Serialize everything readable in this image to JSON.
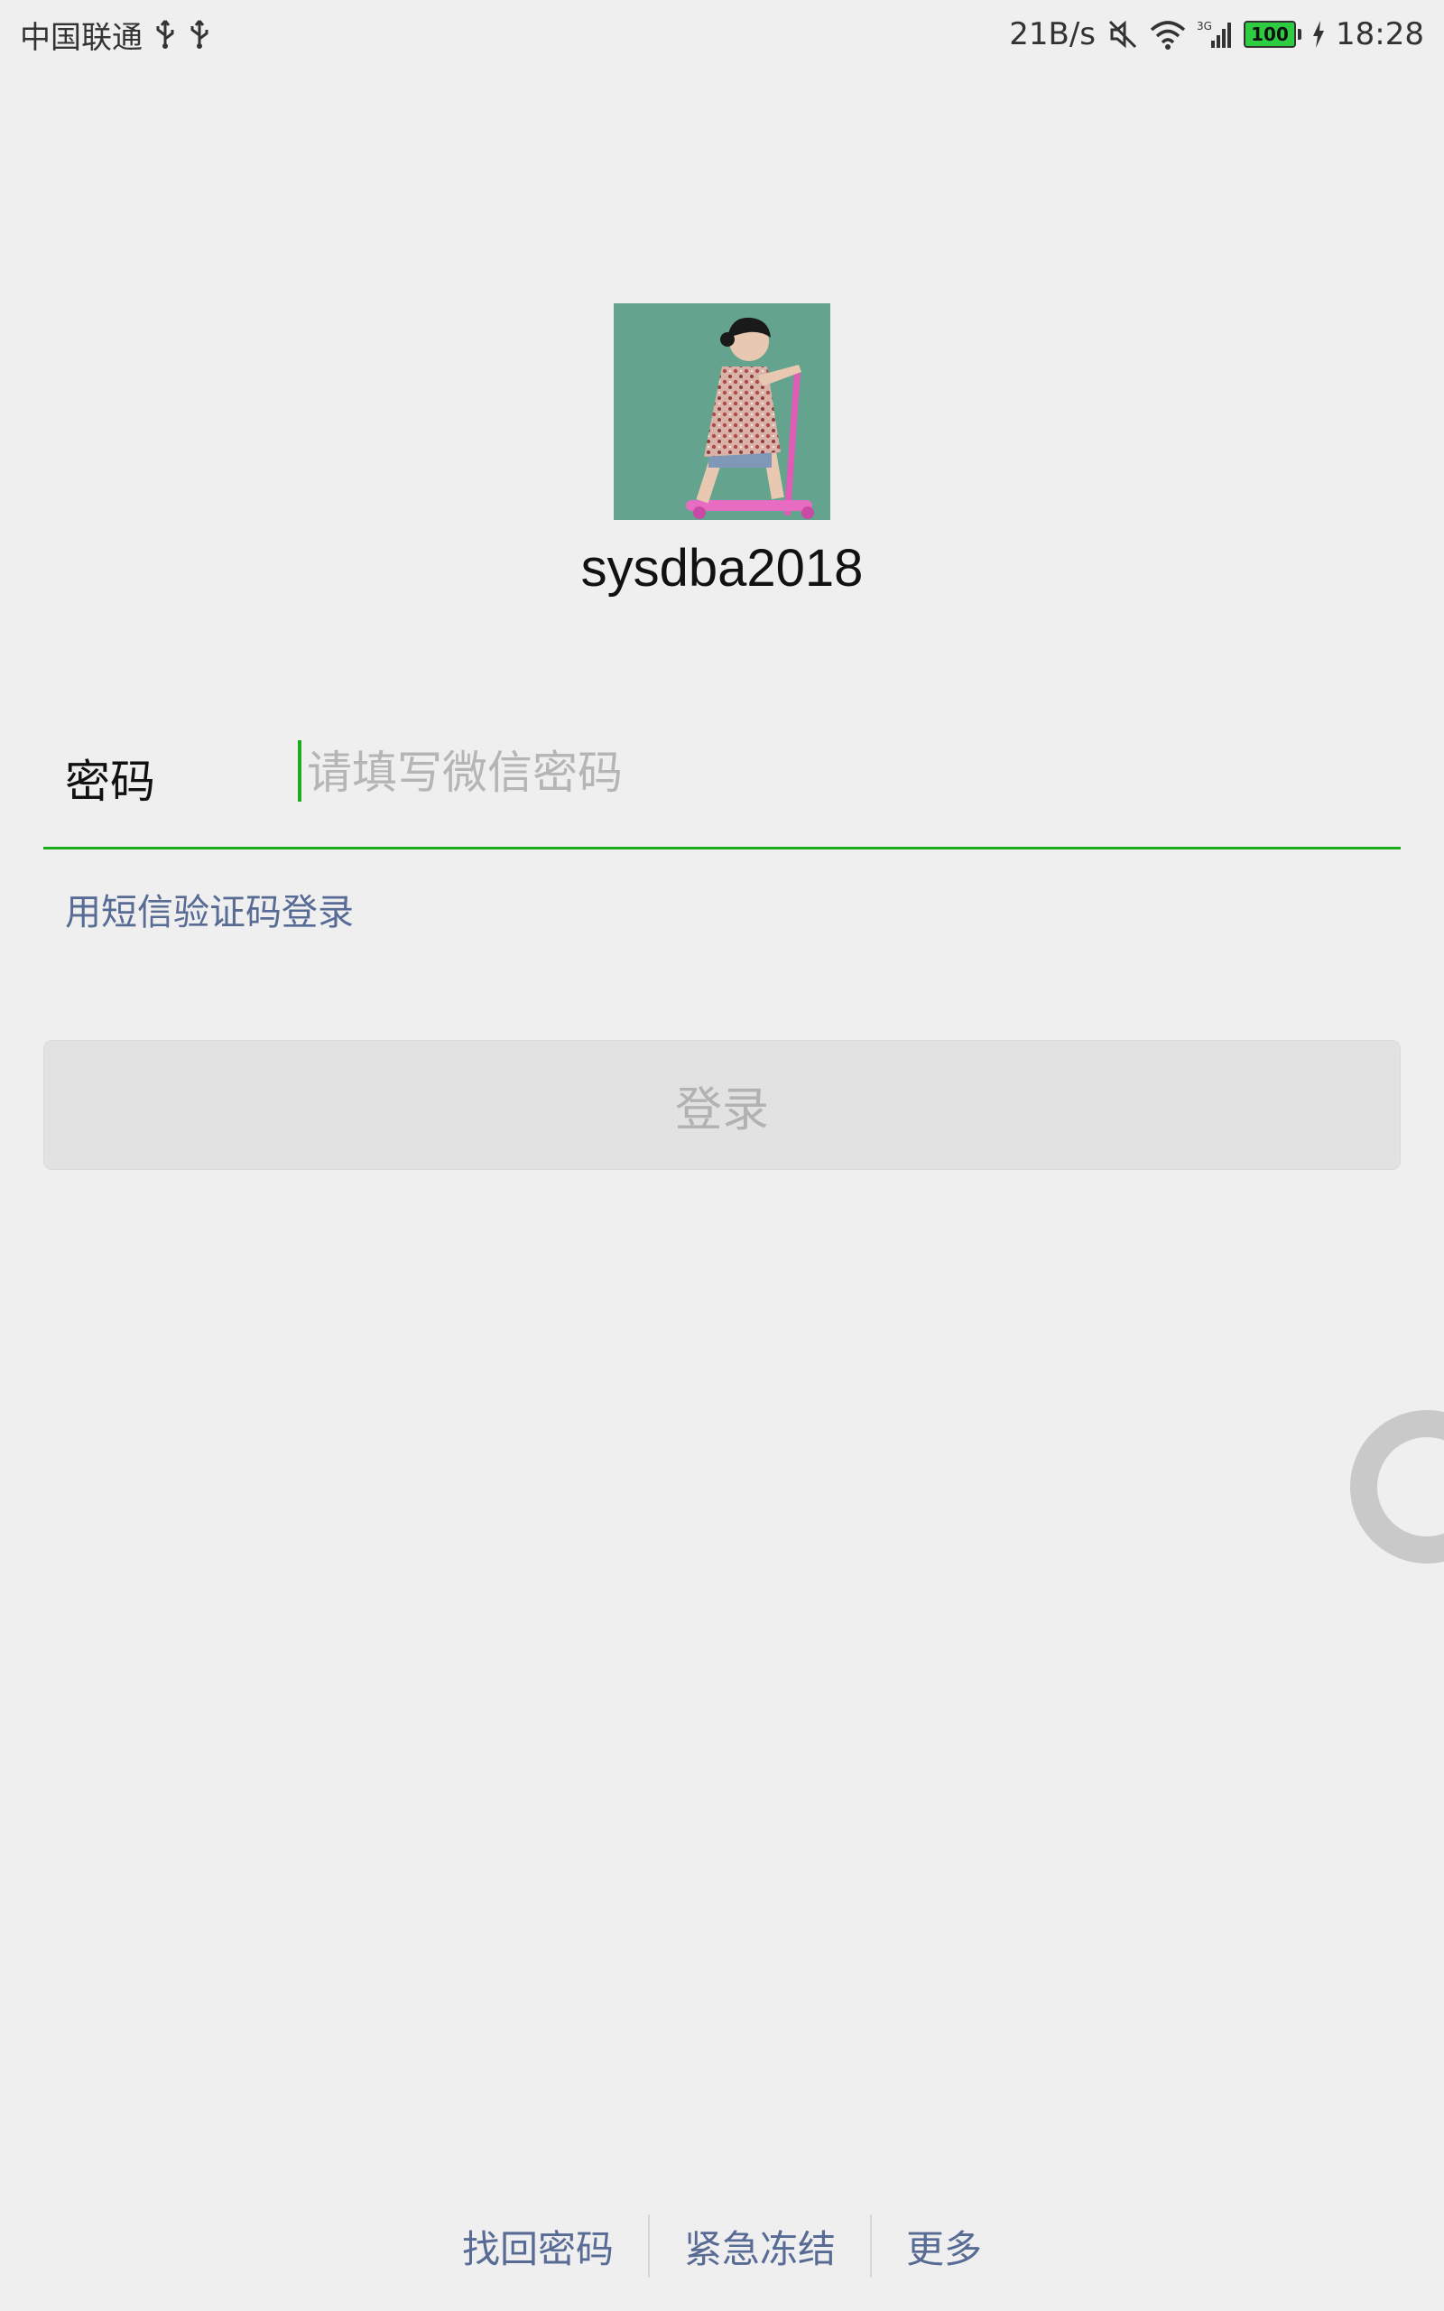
{
  "status_bar": {
    "carrier": "中国联通",
    "net_speed": "21B/s",
    "network_type": "3G",
    "battery_level": "100",
    "time": "18:28"
  },
  "profile": {
    "username": "sysdba2018"
  },
  "password": {
    "label": "密码",
    "placeholder": "请填写微信密码",
    "value": ""
  },
  "sms_login_label": "用短信验证码登录",
  "login_button_label": "登录",
  "bottom_links": {
    "find_password": "找回密码",
    "emergency_freeze": "紧急冻结",
    "more": "更多"
  },
  "colors": {
    "background": "#EFEFEF",
    "accent_green": "#1AAD19",
    "link_blue": "#576B95",
    "disabled_button": "#E2E2E2",
    "battery_green": "#2ECC40"
  }
}
